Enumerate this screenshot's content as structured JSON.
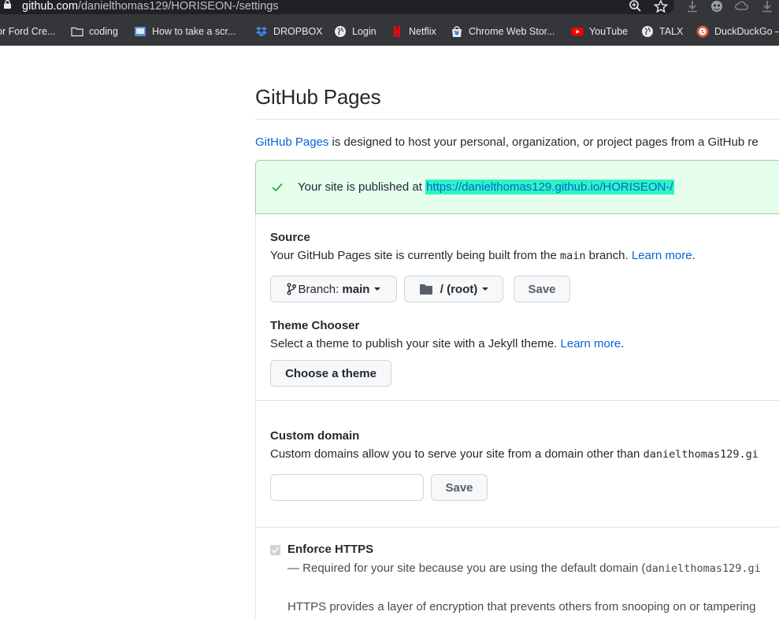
{
  "browser": {
    "url_host": "github.com",
    "url_path": "/danielthomas129/HORISEON-/settings",
    "bookmarks": [
      "or Ford Cre...",
      "coding",
      "How to take a scr...",
      "DROPBOX",
      "Login",
      "Netflix",
      "Chrome Web Stor...",
      "YouTube",
      "TALX",
      "DuckDuckGo –"
    ]
  },
  "page": {
    "title": "GitHub Pages",
    "intro_link": "GitHub Pages",
    "intro_text": " is designed to host your personal, organization, or project pages from a GitHub re"
  },
  "flash": {
    "text": "Your site is published at ",
    "link": "https://danielthomas129.github.io/HORISEON-/"
  },
  "source": {
    "title": "Source",
    "text_before": "Your GitHub Pages site is currently being built from the ",
    "branch_code": "main",
    "text_after": " branch. ",
    "learn_more": "Learn more",
    "period": ".",
    "branch_label": "Branch:",
    "branch_value": "main",
    "folder_value": "/ (root)",
    "save_label": "Save"
  },
  "theme": {
    "title": "Theme Chooser",
    "text": "Select a theme to publish your site with a Jekyll theme. ",
    "learn_more": "Learn more",
    "period": ".",
    "button_label": "Choose a theme"
  },
  "custom_domain": {
    "title": "Custom domain",
    "text": "Custom domains allow you to serve your site from a domain other than ",
    "domain_code": "danielthomas129.gi",
    "input_value": "",
    "save_label": "Save"
  },
  "https": {
    "title": "Enforce HTTPS",
    "checked": true,
    "note": "— Required for your site because you are using the default domain (",
    "note_code": "danielthomas129.gi",
    "description": "HTTPS provides a layer of encryption that prevents others from snooping on or tampering"
  },
  "colors": {
    "link": "#0366d6",
    "flash_bg": "#e6ffed",
    "highlight": "#2ff3c1",
    "check": "#28a745"
  }
}
